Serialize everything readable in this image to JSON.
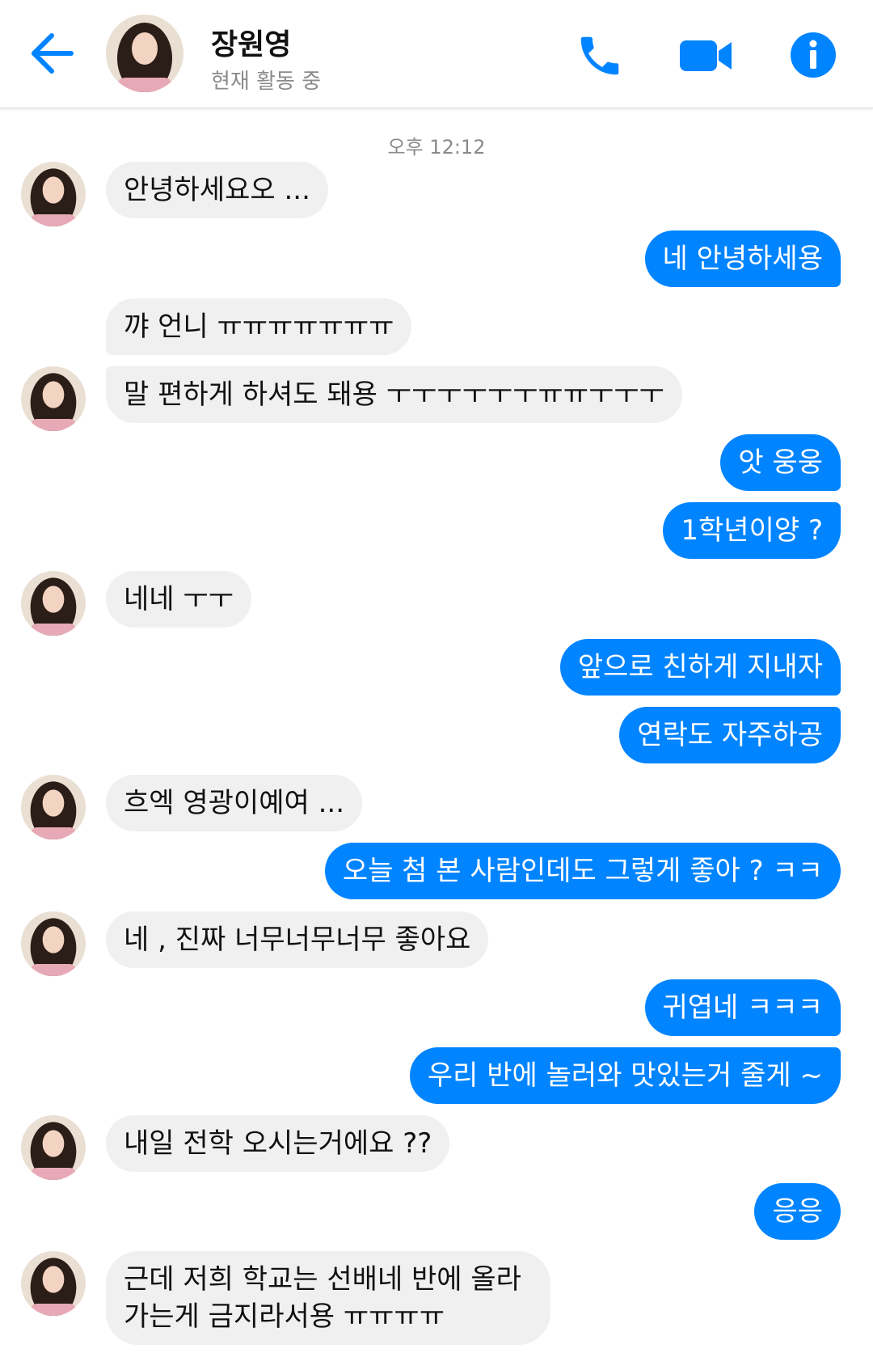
{
  "header": {
    "contact_name": "장원영",
    "status": "현재 활동 중",
    "back_icon": "back-arrow-icon",
    "call_icon": "phone-icon",
    "video_icon": "video-camera-icon",
    "info_icon": "info-icon",
    "accent_color": "#0084ff"
  },
  "timestamp": "오후 12:12",
  "messages": [
    {
      "from": "them",
      "text": "안녕하세요오 ..."
    },
    {
      "from": "me",
      "text": "네 안녕하세용"
    },
    {
      "from": "them",
      "text": "꺄 언니 ㅠㅠㅠㅠㅠㅠㅠ"
    },
    {
      "from": "them",
      "text": "말 편하게 하셔도 돼용 ㅜㅜㅜㅜㅜㅜㅠㅠㅜㅜㅜ"
    },
    {
      "from": "me",
      "text": "앗 웅웅"
    },
    {
      "from": "me",
      "text": "1학년이양 ?"
    },
    {
      "from": "them",
      "text": "네네 ㅜㅜ"
    },
    {
      "from": "me",
      "text": "앞으로 친하게 지내자"
    },
    {
      "from": "me",
      "text": "연락도 자주하공"
    },
    {
      "from": "them",
      "text": "흐엑 영광이예여 ..."
    },
    {
      "from": "me",
      "text": "오늘 첨 본 사람인데도 그렇게 좋아 ? ㅋㅋ"
    },
    {
      "from": "them",
      "text": "네 , 진짜 너무너무너무 좋아요"
    },
    {
      "from": "me",
      "text": "귀엽네 ㅋㅋㅋ"
    },
    {
      "from": "me",
      "text": "우리 반에 놀러와 맛있는거 줄게 ~"
    },
    {
      "from": "them",
      "text": "내일 전학 오시는거에요 ??"
    },
    {
      "from": "me",
      "text": "응응"
    },
    {
      "from": "them",
      "text": "근데 저희 학교는 선배네 반에 올라가는게 금지라서용 ㅠㅠㅠㅠ"
    }
  ]
}
